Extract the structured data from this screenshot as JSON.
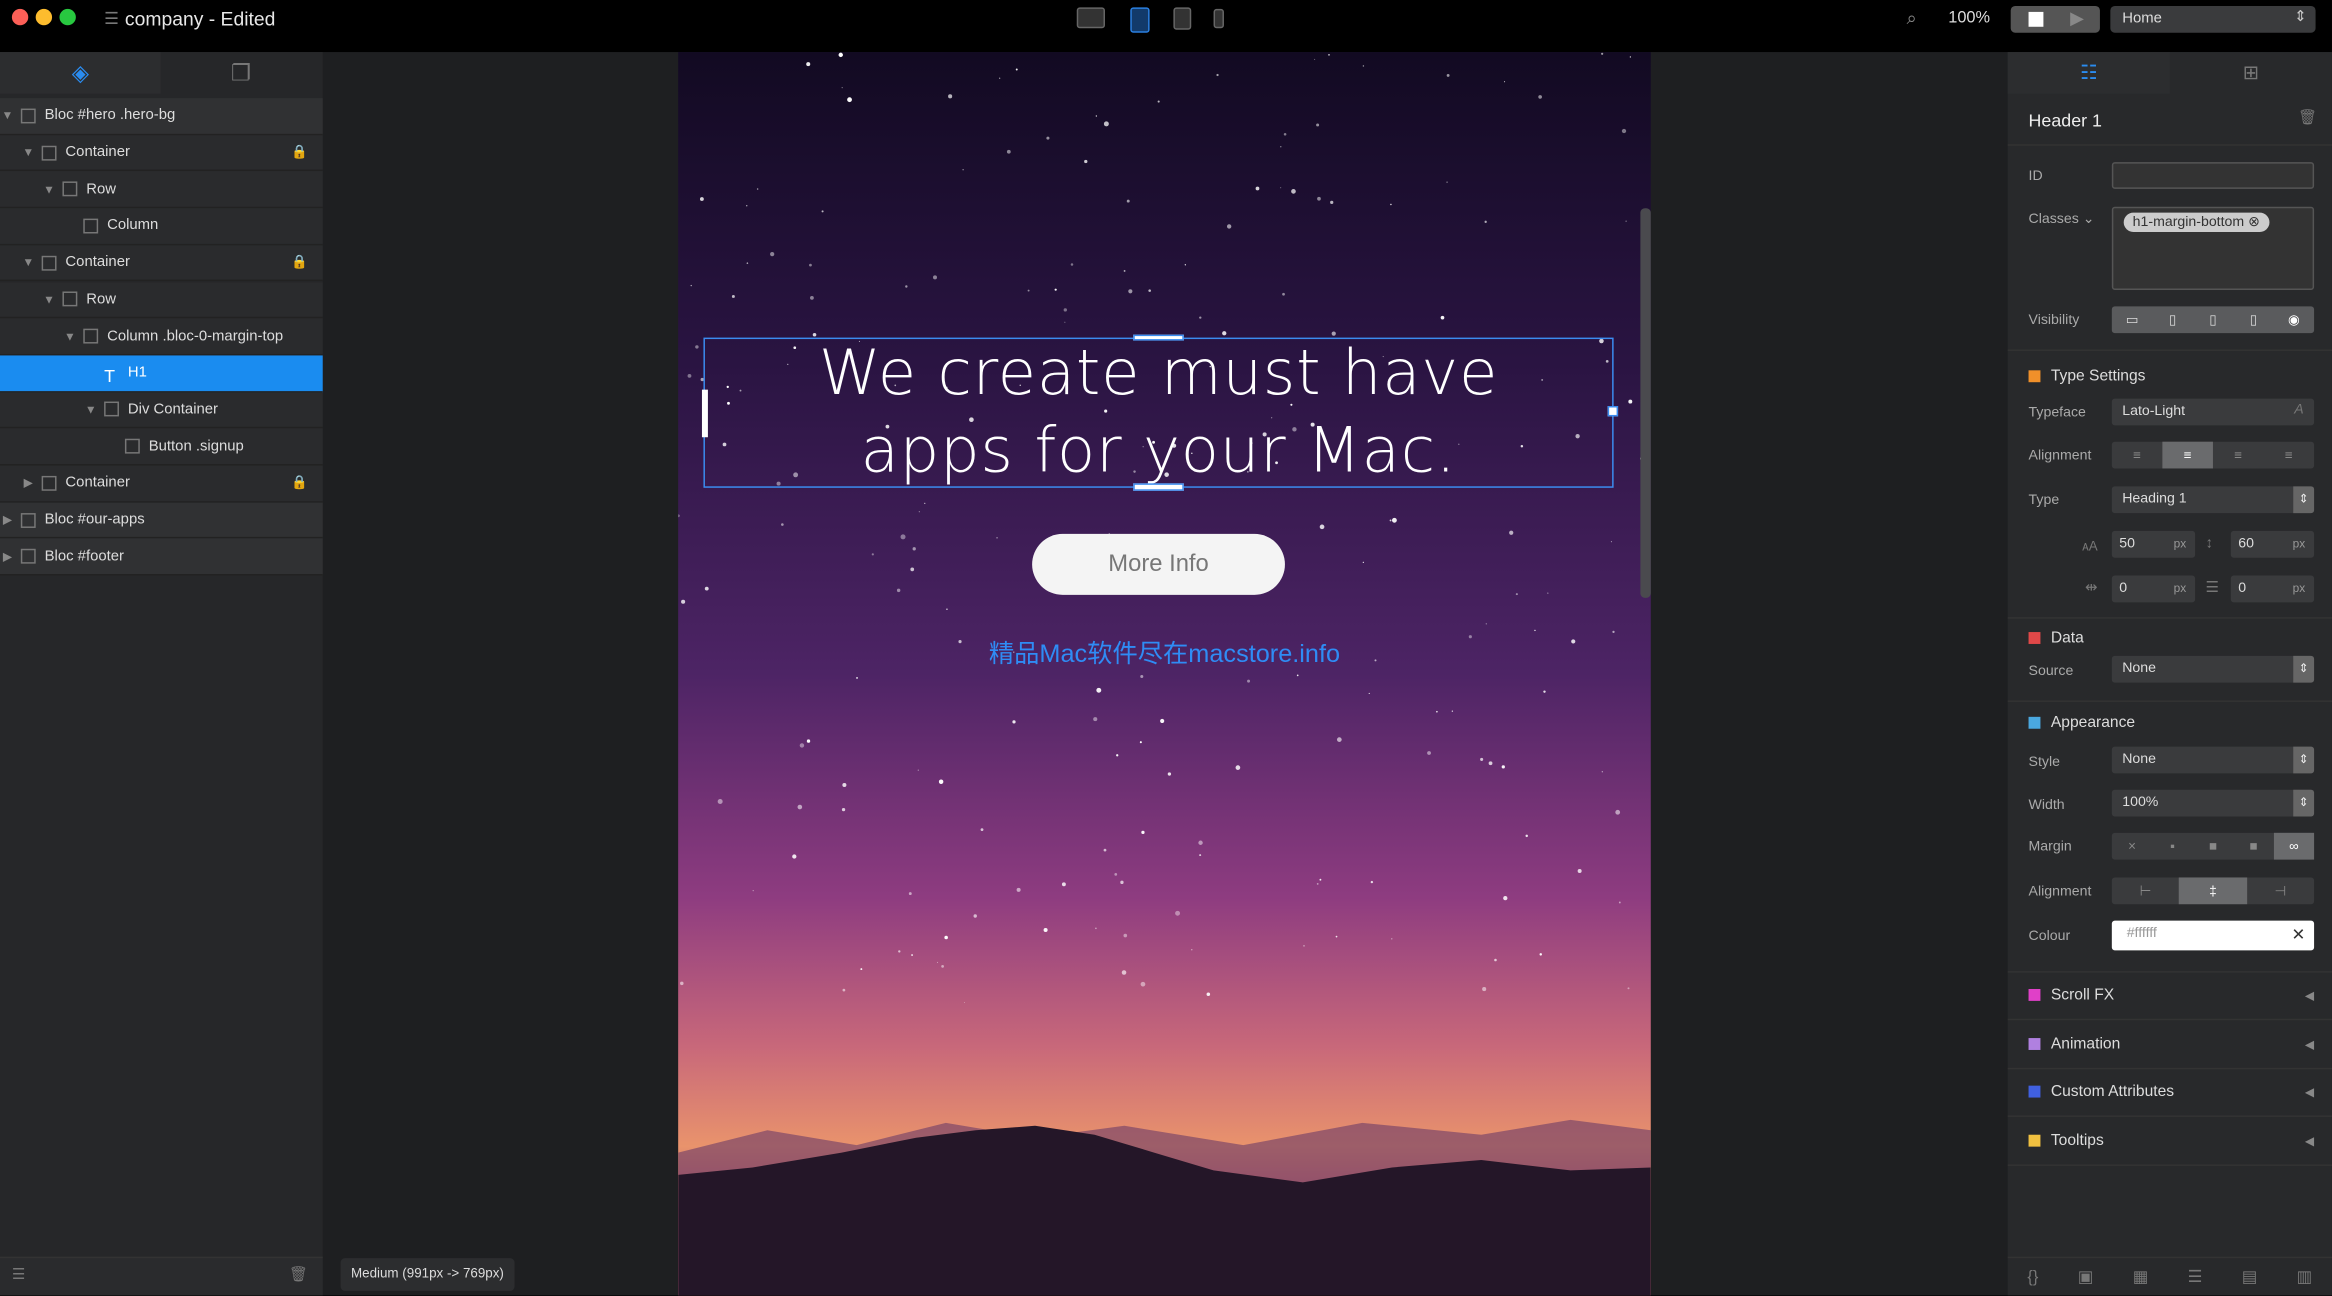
{
  "window": {
    "title": "company - Edited",
    "zoom": "100%",
    "page": "Home"
  },
  "toolbar": {
    "devices": [
      "desktop",
      "tablet-landscape",
      "tablet-portrait",
      "phone"
    ],
    "active_device": "tablet-landscape"
  },
  "layers": {
    "items": [
      {
        "label": "Bloc #hero .hero-bg",
        "depth": 0,
        "expanded": true,
        "bloc": true
      },
      {
        "label": "Container",
        "depth": 1,
        "expanded": true,
        "locked": true
      },
      {
        "label": "Row",
        "depth": 2,
        "expanded": true
      },
      {
        "label": "Column",
        "depth": 3
      },
      {
        "label": "Container",
        "depth": 1,
        "expanded": true,
        "locked": true
      },
      {
        "label": "Row",
        "depth": 2,
        "expanded": true
      },
      {
        "label": "Column .bloc-0-margin-top",
        "depth": 3,
        "expanded": true
      },
      {
        "label": "H1",
        "depth": 4,
        "selected": true
      },
      {
        "label": "Div Container",
        "depth": 4,
        "expanded": true
      },
      {
        "label": "Button .signup",
        "depth": 5
      },
      {
        "label": "Container",
        "depth": 1,
        "expanded": false,
        "locked": true
      },
      {
        "label": "Bloc #our-apps",
        "depth": 0,
        "expanded": false,
        "bloc": true
      },
      {
        "label": "Bloc #footer",
        "depth": 0,
        "expanded": false,
        "bloc": true
      }
    ]
  },
  "canvas": {
    "heading_line1": "We create must have",
    "heading_line2": "apps for your Mac.",
    "button": "More Info",
    "watermark": "精品Mac软件尽在macstore.info",
    "breakpoint": "Medium (991px -> 769px)"
  },
  "inspector": {
    "title": "Header 1",
    "id_label": "ID",
    "id_value": "",
    "classes_label": "Classes",
    "class_tag": "h1-margin-bottom",
    "visibility_label": "Visibility",
    "type_settings": {
      "title": "Type Settings",
      "color": "#f0902a",
      "typeface_label": "Typeface",
      "typeface": "Lato-Light",
      "alignment_label": "Alignment",
      "alignment": "center",
      "type_label": "Type",
      "type": "Heading 1",
      "font_size": "50",
      "line_height": "60",
      "letter_spacing": "0",
      "word_spacing": "0",
      "unit": "px"
    },
    "data": {
      "title": "Data",
      "color": "#e04848",
      "source_label": "Source",
      "source": "None"
    },
    "appearance": {
      "title": "Appearance",
      "color": "#4aa8e0",
      "style_label": "Style",
      "style": "None",
      "width_label": "Width",
      "width": "100%",
      "margin_label": "Margin",
      "alignment_label": "Alignment",
      "alignment": "center",
      "colour_label": "Colour",
      "colour": "#ffffff"
    },
    "collapsed": [
      {
        "title": "Scroll FX",
        "color": "#e040c8"
      },
      {
        "title": "Animation",
        "color": "#b080e0"
      },
      {
        "title": "Custom Attributes",
        "color": "#4060e0"
      },
      {
        "title": "Tooltips",
        "color": "#f0c040"
      }
    ]
  }
}
